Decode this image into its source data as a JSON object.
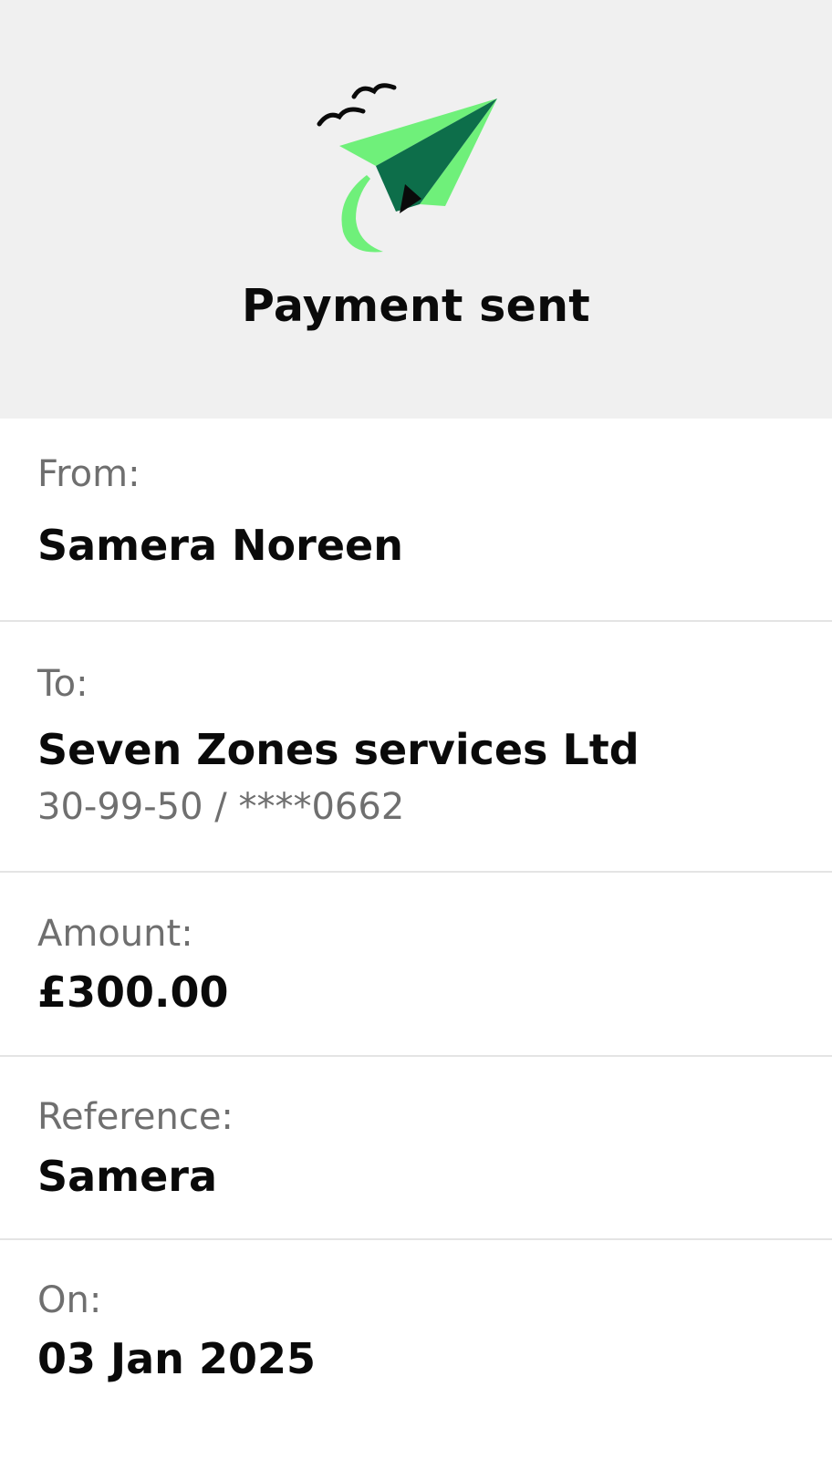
{
  "header": {
    "title": "Payment sent",
    "icon": "paper-plane-icon",
    "accent_color": "#6ff07a",
    "dark_green": "#0d6e4a"
  },
  "details": {
    "from": {
      "label": "From:",
      "value": "Samera Noreen"
    },
    "to": {
      "label": "To:",
      "value": "Seven Zones services Ltd",
      "account": "30-99-50 / ****0662"
    },
    "amount": {
      "label": "Amount:",
      "value": "£300.00"
    },
    "reference": {
      "label": "Reference:",
      "value": "Samera"
    },
    "date": {
      "label": "On:",
      "value": "03 Jan 2025"
    }
  }
}
